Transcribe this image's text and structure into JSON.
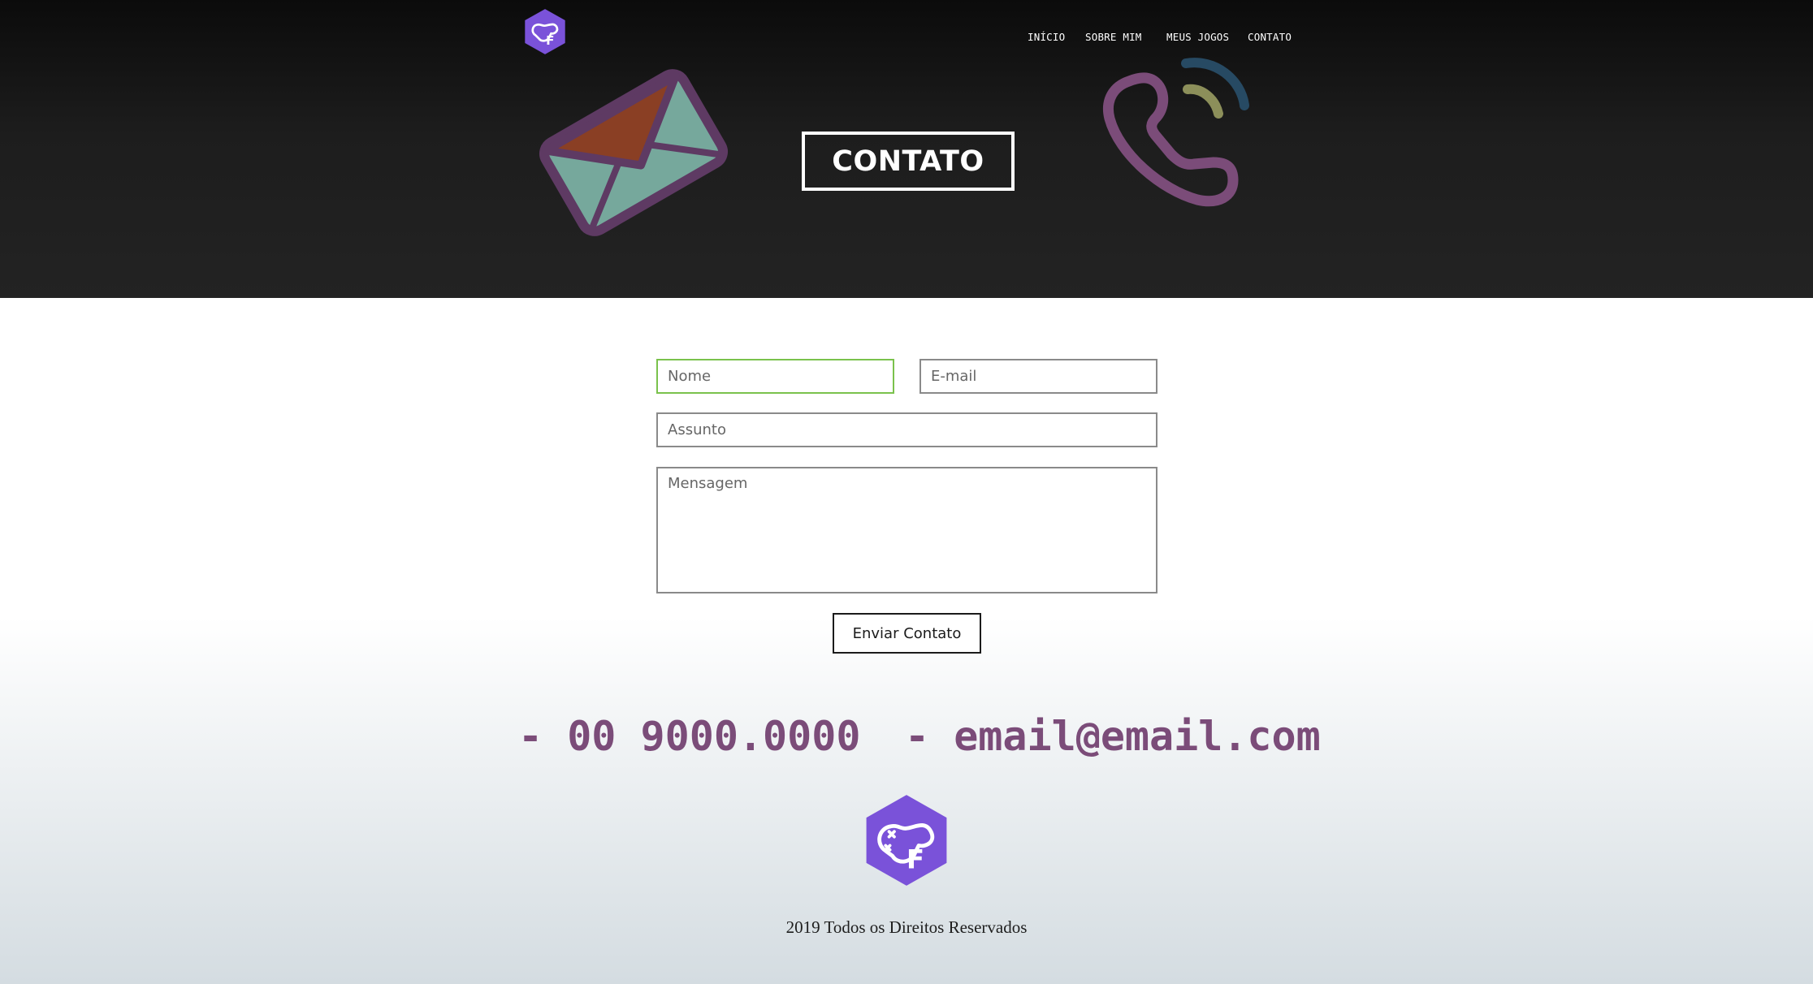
{
  "nav": {
    "items": [
      {
        "label": "INÍCIO"
      },
      {
        "label": "SOBRE MIM"
      },
      {
        "label": "MEUS JOGOS"
      },
      {
        "label": "CONTATO"
      }
    ]
  },
  "hero": {
    "title": "CONTATO",
    "left_icon": "envelope-icon",
    "right_icon": "phone-call-icon"
  },
  "form": {
    "name_placeholder": "Nome",
    "email_placeholder": "E-mail",
    "subject_placeholder": "Assunto",
    "message_placeholder": "Mensagem",
    "submit_label": "Enviar Contato"
  },
  "contacts": {
    "phone": "- 00 9000.0000",
    "email": "- email@email.com"
  },
  "footer": {
    "copyright": "2019 Todos os Direitos Reservados"
  },
  "colors": {
    "brand_purple": "#7a52d9",
    "contact_text": "#7b4c79",
    "active_field_border": "#7ac24c",
    "hero_dark": "#1d1d1d"
  }
}
